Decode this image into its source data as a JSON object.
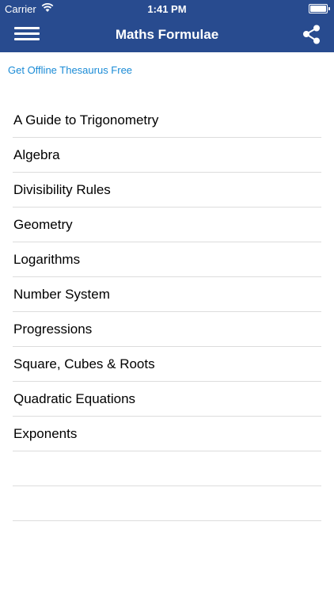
{
  "status_bar": {
    "carrier": "Carrier",
    "time": "1:41 PM"
  },
  "header": {
    "title": "Maths Formulae",
    "menu_icon": "hamburger-menu-icon",
    "share_icon": "share-icon",
    "background": "#284b8f"
  },
  "promo": {
    "link_text": "Get Offline Thesaurus Free",
    "color": "#1a8bd6"
  },
  "topics": [
    "A Guide to Trigonometry",
    "Algebra",
    "Divisibility Rules",
    "Geometry",
    "Logarithms",
    "Number System",
    "Progressions",
    "Square, Cubes & Roots",
    "Quadratic Equations",
    "Exponents"
  ]
}
